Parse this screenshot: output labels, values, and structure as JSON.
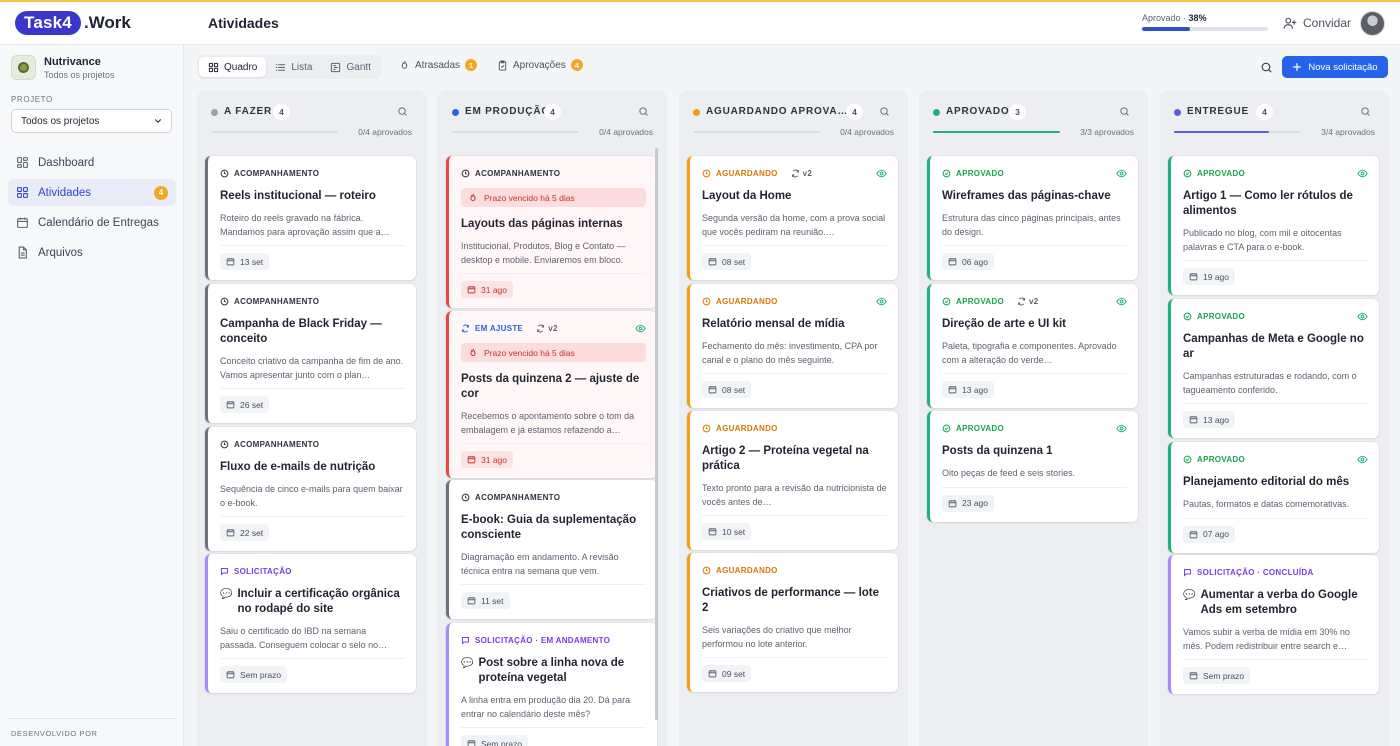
{
  "app": {
    "logo_pill": "Task4",
    "logo_rest": ".Work"
  },
  "header": {
    "page_title": "Atividades",
    "approved_label": "Aprovado ·",
    "approved_pct": "38%",
    "approved_fraction": 0.38,
    "invite_label": "Convidar"
  },
  "sidebar": {
    "workspace_name": "Nutrivance",
    "workspace_sub": "Todos os projetos",
    "project_label": "PROJETO",
    "project_value": "Todos os projetos",
    "items": [
      {
        "label": "Dashboard",
        "icon": "dashboard-icon"
      },
      {
        "label": "Atividades",
        "icon": "grid-icon",
        "badge": "4"
      },
      {
        "label": "Calendário de Entregas",
        "icon": "calendar-icon"
      },
      {
        "label": "Arquivos",
        "icon": "file-icon"
      }
    ],
    "developed_by": "DESENVOLVIDO POR"
  },
  "toolbar": {
    "tabs": [
      "Quadro",
      "Lista",
      "Gantt"
    ],
    "overdue_label": "Atrasadas",
    "overdue_count": "1",
    "approvals_label": "Aprovações",
    "approvals_count": "4",
    "new_button": "Nova solicitação"
  },
  "columns": [
    {
      "title": "A FAZER",
      "count": "4",
      "progress": "0/4 aprovados",
      "fill": 0,
      "color": "#9aa0ad",
      "cards": [
        {
          "tag": "ACOMPANHAMENTO",
          "kind": "follow",
          "title": "Reels institucional — roteiro",
          "desc": "Roteiro do reels gravado na fábrica. Mandamos para aprovação assim que a…",
          "date": "13 set"
        },
        {
          "tag": "ACOMPANHAMENTO",
          "kind": "follow",
          "title": "Campanha de Black Friday — conceito",
          "desc": "Conceito criativo da campanha de fim de ano. Vamos apresentar junto com o plan…",
          "date": "26 set"
        },
        {
          "tag": "ACOMPANHAMENTO",
          "kind": "follow",
          "title": "Fluxo de e-mails de nutrição",
          "desc": "Sequência de cinco e-mails para quem baixar o e-book.",
          "date": "22 set"
        },
        {
          "tag": "SOLICITAÇÃO",
          "kind": "request",
          "title": "Incluir a certificação orgânica no rodapé do site",
          "desc": "Saiu o certificado do IBD na semana passada. Conseguem colocar o selo no…",
          "date": "Sem prazo",
          "chat": true
        }
      ]
    },
    {
      "title": "EM PRODUÇÃO",
      "count": "4",
      "progress": "0/4 aprovados",
      "fill": 0,
      "color": "#2563eb",
      "cards": [
        {
          "tag": "ACOMPANHAMENTO",
          "kind": "follow",
          "overdue": "Prazo vencido há 5 dias",
          "title": "Layouts das páginas internas",
          "desc": "Institucional, Produtos, Blog e Contato — desktop e mobile. Enviaremos em bloco.",
          "date": "31 ago",
          "danger": true
        },
        {
          "tag": "EM AJUSTE",
          "kind": "adjust",
          "version": "v2",
          "eye": true,
          "overdue": "Prazo vencido há 5 dias",
          "title": "Posts da quinzena 2 — ajuste de cor",
          "desc": "Recebemos o apontamento sobre o tom da embalagem e já estamos refazendo a…",
          "date": "31 ago",
          "danger": true
        },
        {
          "tag": "ACOMPANHAMENTO",
          "kind": "follow",
          "title": "E-book: Guia da suplementação consciente",
          "desc": "Diagramação em andamento. A revisão técnica entra na semana que vem.",
          "date": "11 set"
        },
        {
          "tag": "SOLICITAÇÃO · EM ANDAMENTO",
          "kind": "request",
          "title": "Post sobre a linha nova de proteína vegetal",
          "desc": "A linha entra em produção dia 20. Dá para entrar no calendário deste mês?",
          "date": "Sem prazo",
          "chat": true
        }
      ]
    },
    {
      "title": "AGUARDANDO APROVA…",
      "count": "4",
      "progress": "0/4 aprovados",
      "fill": 0,
      "color": "#f59e0b",
      "cards": [
        {
          "tag": "AGUARDANDO",
          "kind": "waiting",
          "version": "v2",
          "eye": true,
          "title": "Layout da Home",
          "desc": "Segunda versão da home, com a prova social que vocês pediram na reunião.…",
          "date": "08 set"
        },
        {
          "tag": "AGUARDANDO",
          "kind": "waiting",
          "eye": true,
          "title": "Relatório mensal de mídia",
          "desc": "Fechamento do mês: investimento, CPA por canal e o plano do mês seguinte.",
          "date": "08 set"
        },
        {
          "tag": "AGUARDANDO",
          "kind": "waiting",
          "title": "Artigo 2 — Proteína vegetal na prática",
          "desc": "Texto pronto para a revisão da nutricionista de vocês antes de…",
          "date": "10 set"
        },
        {
          "tag": "AGUARDANDO",
          "kind": "waiting",
          "title": "Criativos de performance — lote 2",
          "desc": "Seis variações do criativo que melhor performou no lote anterior.",
          "date": "09 set"
        }
      ]
    },
    {
      "title": "APROVADO",
      "count": "3",
      "progress": "3/3 aprovados",
      "fill": 1,
      "color": "#22b07d",
      "cards": [
        {
          "tag": "APROVADO",
          "kind": "approved",
          "eye": true,
          "title": "Wireframes das páginas-chave",
          "desc": "Estrutura das cinco páginas principais, antes do design.",
          "date": "06 ago"
        },
        {
          "tag": "APROVADO",
          "kind": "approved",
          "version": "v2",
          "eye": true,
          "title": "Direção de arte e UI kit",
          "desc": "Paleta, tipografia e componentes. Aprovado com a alteração do verde…",
          "date": "13 ago"
        },
        {
          "tag": "APROVADO",
          "kind": "approved",
          "eye": true,
          "title": "Posts da quinzena 1",
          "desc": "Oito peças de feed e seis stories.",
          "date": "23 ago"
        }
      ]
    },
    {
      "title": "ENTREGUE",
      "count": "4",
      "progress": "3/4 aprovados",
      "fill": 0.75,
      "color": "#5b5fdb",
      "cards": [
        {
          "tag": "APROVADO",
          "kind": "approved",
          "eye": true,
          "title": "Artigo 1 — Como ler rótulos de alimentos",
          "desc": "Publicado no blog, com mil e oitocentas palavras e CTA para o e-book.",
          "date": "19 ago"
        },
        {
          "tag": "APROVADO",
          "kind": "approved",
          "eye": true,
          "title": "Campanhas de Meta e Google no ar",
          "desc": "Campanhas estruturadas e rodando, com o tagueamento conferido.",
          "date": "13 ago"
        },
        {
          "tag": "APROVADO",
          "kind": "approved",
          "eye": true,
          "title": "Planejamento editorial do mês",
          "desc": "Pautas, formatos e datas comemorativas.",
          "date": "07 ago"
        },
        {
          "tag": "SOLICITAÇÃO · CONCLUÍDA",
          "kind": "request",
          "title": "Aumentar a verba do Google Ads em setembro",
          "desc": "Vamos subir a verba de mídia em 30% no mês. Podem redistribuir entre search e…",
          "date": "Sem prazo",
          "chat": true
        }
      ]
    }
  ]
}
